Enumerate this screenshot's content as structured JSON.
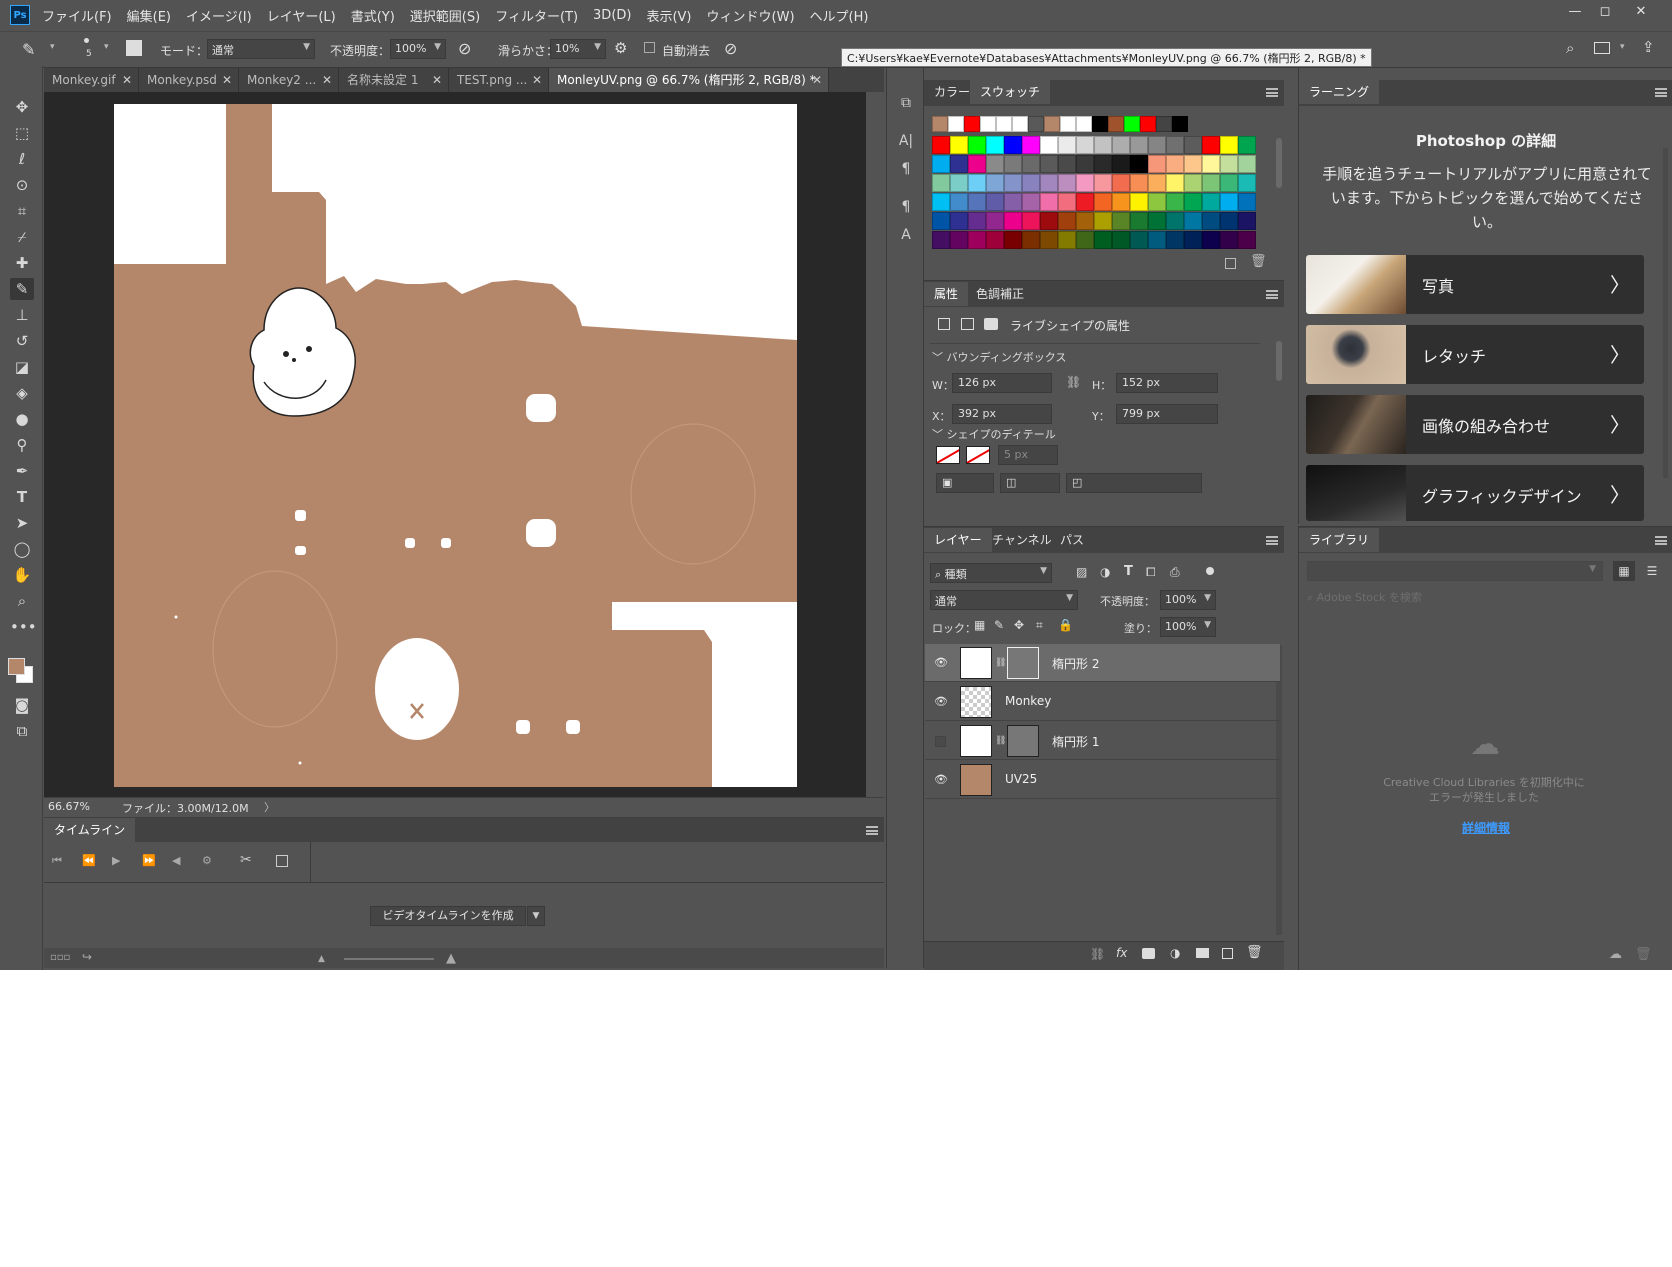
{
  "menu": [
    "ファイル(F)",
    "編集(E)",
    "イメージ(I)",
    "レイヤー(L)",
    "書式(Y)",
    "選択範囲(S)",
    "フィルター(T)",
    "3D(D)",
    "表示(V)",
    "ウィンドウ(W)",
    "ヘルプ(H)"
  ],
  "app_logo": "Ps",
  "options": {
    "brush_size": "5",
    "mode_label": "モード：",
    "mode_value": "通常",
    "opacity_label": "不透明度：",
    "opacity_value": "100%",
    "smoothing_label": "滑らかさ：",
    "smoothing_value": "10%",
    "auto_erase_label": "自動消去"
  },
  "tooltip": "C:¥Users¥kae¥Evernote¥Databases¥Attachments¥MonleyUV.png @ 66.7% (楕円形 2, RGB/8) *",
  "doc_tabs": [
    {
      "label": "Monkey.gif"
    },
    {
      "label": "Monkey.psd"
    },
    {
      "label": "Monkey2 ..."
    },
    {
      "label": "名称未設定 1"
    },
    {
      "label": "TEST.png ..."
    },
    {
      "label": "MonleyUV.png @ 66.7% (楕円形 2, RGB/8) *"
    }
  ],
  "status": {
    "zoom": "66.67%",
    "file": "ファイル：3.00M/12.0M"
  },
  "timeline": {
    "title": "タイムライン",
    "create_button": "ビデオタイムラインを作成"
  },
  "colors": {
    "foreground": "#b5876a",
    "canvas_fill": "#b5876a"
  },
  "swatches_panel": {
    "tabs": [
      "カラー",
      "スウォッチ"
    ],
    "recent": [
      "#b5876a",
      "#ffffff",
      "#ff0000",
      "#ffffff",
      "#ffffff",
      "#ffffff",
      "#595959",
      "#b5876a",
      "#ffffff",
      "#ffffff",
      "#000000",
      "#a0522d",
      "#00ff00",
      "#ff0000",
      "#444444",
      "#000000"
    ],
    "rows": [
      [
        "#ff0000",
        "#ffff00",
        "#00ff00",
        "#00ffff",
        "#0000ff",
        "#ff00ff",
        "#ffffff",
        "#ebebeb",
        "#d6d6d6",
        "#c2c2c2",
        "#adadad",
        "#999999",
        "#858585",
        "#707070",
        "#5c5c5c",
        "#ff0000",
        "#ffff00",
        "#00a550"
      ],
      [
        "#00aeef",
        "#2e3192",
        "#ec008c",
        "#8a8a8a",
        "#7a7a7a",
        "#6a6a6a",
        "#5a5a5a",
        "#4a4a4a",
        "#3a3a3a",
        "#2a2a2a",
        "#1a1a1a",
        "#000000",
        "#f7977a",
        "#f9ad81",
        "#fdc68a",
        "#fff79a",
        "#c4df9b",
        "#a2d39c"
      ],
      [
        "#82ca9d",
        "#7bcdc8",
        "#6ecff6",
        "#7ea7d8",
        "#8493ca",
        "#8882be",
        "#a187be",
        "#bc8dbf",
        "#f49ac2",
        "#f6989d",
        "#f26c4f",
        "#f68e55",
        "#fbaf5c",
        "#fff467",
        "#acd372",
        "#7cc576",
        "#3bb878",
        "#1abbb4"
      ],
      [
        "#00bff3",
        "#438ccb",
        "#5574b9",
        "#605ca8",
        "#855fa8",
        "#a763a8",
        "#f06ea9",
        "#f26d7d",
        "#ed1c24",
        "#f26522",
        "#f7941d",
        "#fff200",
        "#8dc63f",
        "#39b54a",
        "#00a651",
        "#00a99d",
        "#00aeef",
        "#0072bc"
      ],
      [
        "#0054a6",
        "#2e3192",
        "#662d91",
        "#92278f",
        "#ec008c",
        "#ed145b",
        "#9e0b0f",
        "#a0410d",
        "#a36209",
        "#aba000",
        "#598527",
        "#1a7b30",
        "#007236",
        "#00746b",
        "#0076a3",
        "#004b80",
        "#003471",
        "#1b1464"
      ],
      [
        "#440e62",
        "#630460",
        "#9e005d",
        "#9e0039",
        "#790000",
        "#7b2e00",
        "#7d4900",
        "#827b00",
        "#406618",
        "#005e20",
        "#005826",
        "#005952",
        "#005b7f",
        "#003663",
        "#002157",
        "#0d004c",
        "#32004b",
        "#4b0049"
      ]
    ]
  },
  "properties": {
    "tabs": [
      "属性",
      "色調補正"
    ],
    "live_shape_label": "ライブシェイプの属性",
    "bbox_section": "バウンディングボックス",
    "w_label": "W：",
    "w_value": "126 px",
    "h_label": "H：",
    "h_value": "152 px",
    "x_label": "X：",
    "x_value": "392 px",
    "y_label": "Y：",
    "y_value": "799 px",
    "shape_section": "シェイプのディテール",
    "stroke_width": "5 px"
  },
  "layers_panel": {
    "tabs": [
      "レイヤー",
      "チャンネル",
      "パス"
    ],
    "filter_label": "種類",
    "blend_mode": "通常",
    "opacity_label": "不透明度：",
    "opacity_value": "100%",
    "lock_label": "ロック：",
    "fill_label": "塗り：",
    "fill_value": "100%",
    "layers": [
      {
        "name": "楕円形 2",
        "visible": true,
        "selected": true
      },
      {
        "name": "Monkey",
        "visible": true,
        "selected": false
      },
      {
        "name": "楕円形 1",
        "visible": false,
        "selected": false
      },
      {
        "name": "UV25",
        "visible": true,
        "selected": false
      }
    ]
  },
  "learn_panel": {
    "tab": "ラーニング",
    "heading": "Photoshop の詳細",
    "description": "手順を追うチュートリアルがアプリに用意されています。下からトピックを選んで始めてください。",
    "cards": [
      "写真",
      "レタッチ",
      "画像の組み合わせ",
      "グラフィックデザイン"
    ]
  },
  "libraries_panel": {
    "tab": "ライブラリ",
    "search_placeholder": "Adobe Stock を検索",
    "error_message": "Creative Cloud Libraries を初期化中にエラーが発生しました",
    "details_link": "詳細情報"
  }
}
